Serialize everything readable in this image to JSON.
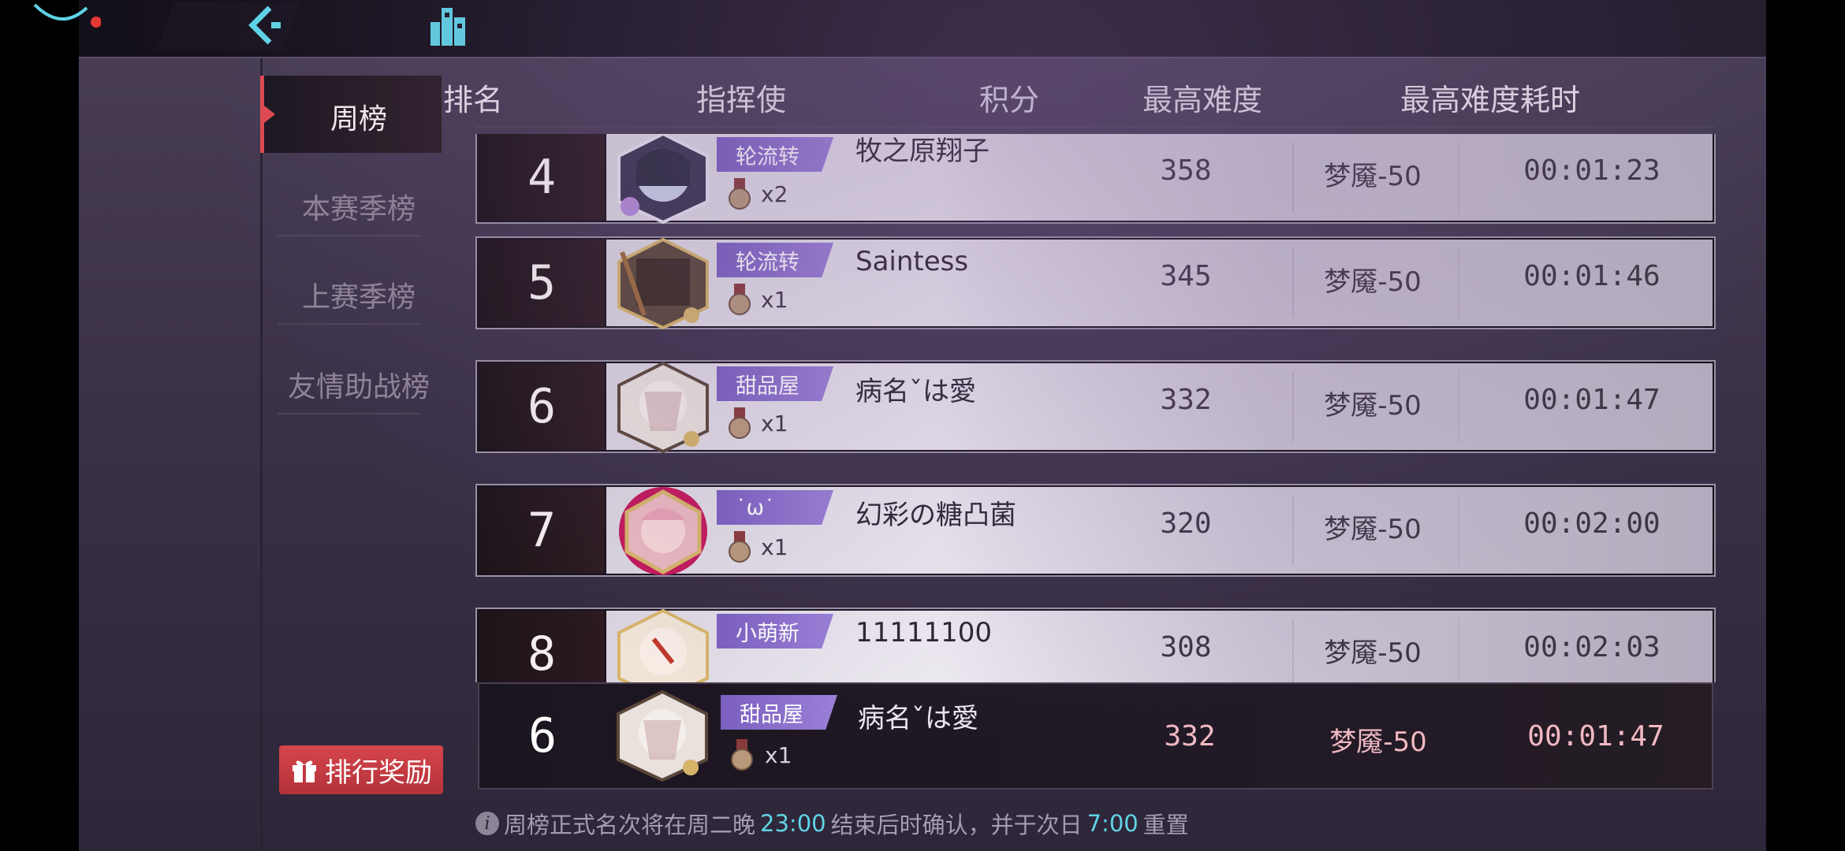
{
  "nav": {
    "items": [
      {
        "label": "周榜",
        "active": true
      },
      {
        "label": "本赛季榜",
        "active": false
      },
      {
        "label": "上赛季榜",
        "active": false
      },
      {
        "label": "友情助战榜",
        "active": false
      }
    ],
    "reward_button": "排行奖励"
  },
  "table": {
    "headers": [
      "排名",
      "指挥使",
      "积分",
      "最高难度",
      "最高难度耗时"
    ],
    "rows": [
      {
        "rank": "4",
        "tag": "轮流转",
        "name": "牧之原翔子",
        "medals": "x2",
        "score": "358",
        "difficulty": "梦魇-50",
        "time": "00:01:23"
      },
      {
        "rank": "5",
        "tag": "轮流转",
        "name": "Saintess",
        "medals": "x1",
        "score": "345",
        "difficulty": "梦魇-50",
        "time": "00:01:46"
      },
      {
        "rank": "6",
        "tag": "甜品屋",
        "name": "病名ˇは愛",
        "medals": "x1",
        "score": "332",
        "difficulty": "梦魇-50",
        "time": "00:01:47"
      },
      {
        "rank": "7",
        "tag": "˙ω˙",
        "name": "幻彩の糖凸菌",
        "medals": "x1",
        "score": "320",
        "difficulty": "梦魇-50",
        "time": "00:02:00"
      },
      {
        "rank": "8",
        "tag": "小萌新",
        "name": "11111100",
        "medals": "x1",
        "score": "308",
        "difficulty": "梦魇-50",
        "time": "00:02:03"
      }
    ]
  },
  "my_row": {
    "rank": "6",
    "tag": "甜品屋",
    "name": "病名ˇは愛",
    "medals": "x1",
    "score": "332",
    "difficulty": "梦魇-50",
    "time": "00:01:47"
  },
  "notice": {
    "prefix": "周榜正式名次将在周二晚 ",
    "time1": "23:00",
    "middle": "结束后时确认，并于次日 ",
    "time2": "7:00",
    "suffix": " 重置"
  },
  "colors": {
    "accent": "#e04a52",
    "tag": "#8a6fcd",
    "highlight": "#5fd4e6"
  }
}
